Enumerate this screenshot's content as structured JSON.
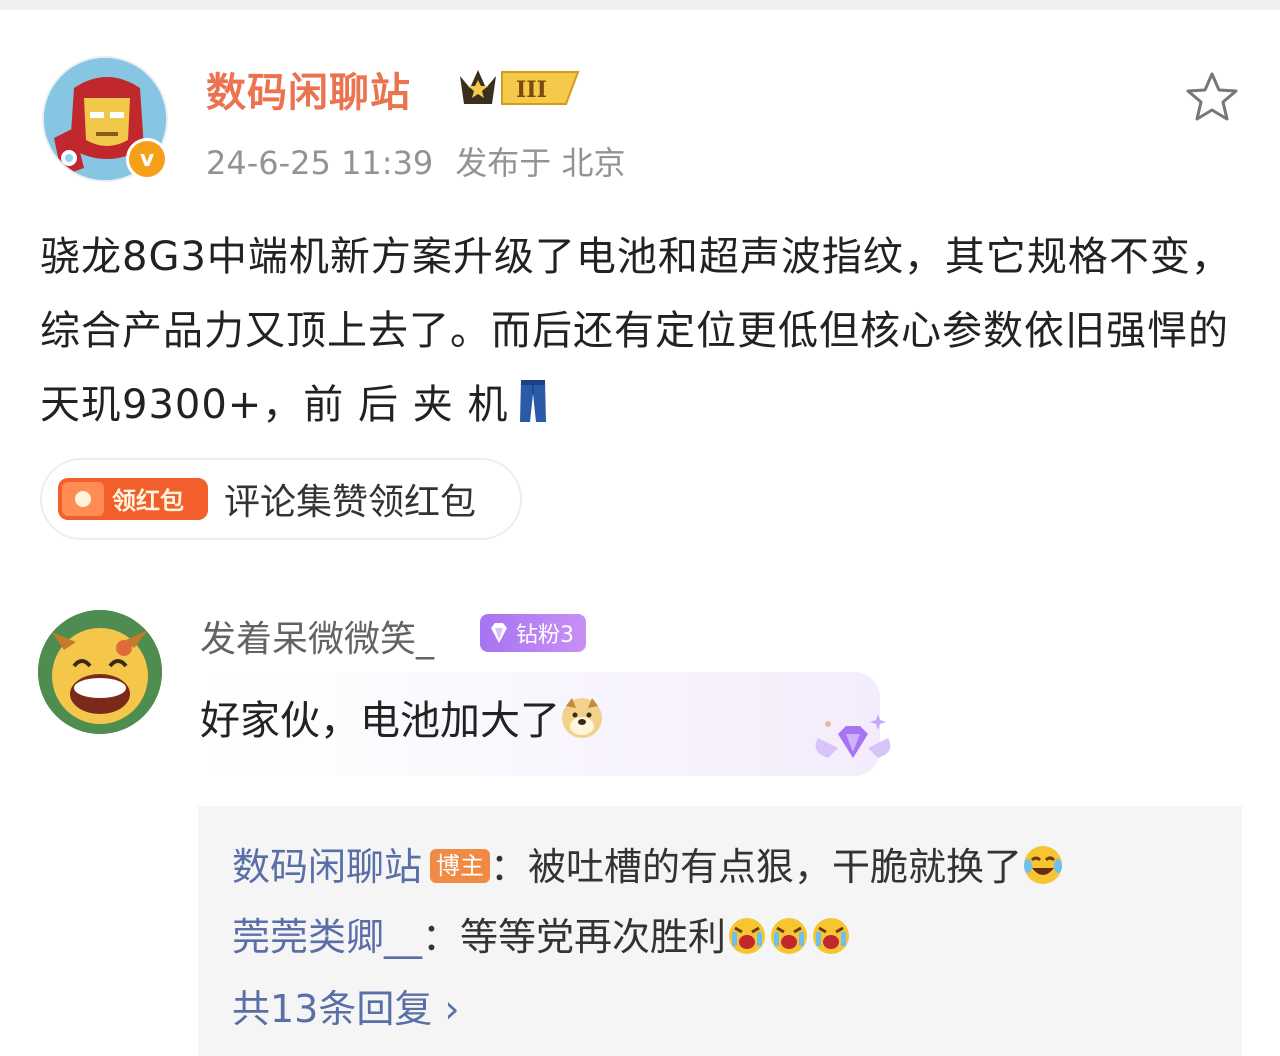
{
  "post": {
    "author": "数码闲聊站",
    "level_badge": "III",
    "verified_mark": "v",
    "time": "24-6-25 11:39",
    "location": "发布于 北京",
    "text": "骁龙8G3中端机新方案升级了电池和超声波指纹，其它规格不变，综合产品力又顶上去了。而后还有定位更低但核心参数依旧强悍的天玑9300+，前 后 夹 机",
    "trailing_icon": "jeans-icon",
    "red_packet_label": "领红包",
    "red_packet_text": "评论集赞领红包"
  },
  "comment": {
    "author": "发着呆微微笑_",
    "fan_badge": "钻粉3",
    "text": "好家伙，电池加大了",
    "emoji": "doge-icon"
  },
  "replies": [
    {
      "author": "数码闲聊站",
      "tag": "博主",
      "text": "：被吐槽的有点狠，干脆就换了",
      "emoji": "laugh-cry-icon"
    },
    {
      "author": "莞莞类卿__",
      "text": "：等等党再次胜利",
      "emoji": "crying-icon"
    }
  ],
  "more_replies": "共13条回复 ›",
  "colors": {
    "author_orange": "#eb7350",
    "link_blue": "#5a6ea8",
    "meta_gray": "#939393",
    "fan_purple": "#a774f2"
  }
}
